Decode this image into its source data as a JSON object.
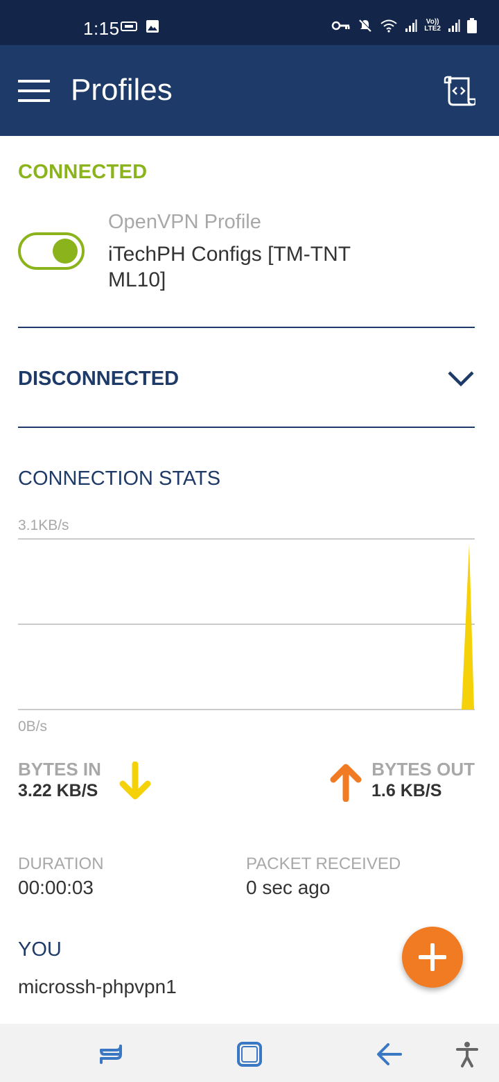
{
  "status_bar": {
    "time": "1:15",
    "lte_line1": "Vo))",
    "lte_line2": "LTE2"
  },
  "app_bar": {
    "title": "Profiles"
  },
  "connected": {
    "heading": "CONNECTED",
    "profile_type": "OpenVPN Profile",
    "profile_name": "iTechPH Configs [TM-TNT ML10]",
    "toggle_on": true
  },
  "disconnected": {
    "heading": "DISCONNECTED"
  },
  "stats": {
    "heading": "CONNECTION STATS",
    "chart_max_label": "3.1KB/s",
    "chart_min_label": "0B/s",
    "bytes_in_label": "BYTES IN",
    "bytes_in_value": "3.22 KB/S",
    "bytes_out_label": "BYTES OUT",
    "bytes_out_value": "1.6 KB/S",
    "duration_label": "DURATION",
    "duration_value": "00:00:03",
    "packet_label": "PACKET RECEIVED",
    "packet_value": "0 sec ago"
  },
  "you": {
    "label": "YOU",
    "value": "microssh-phpvpn1"
  },
  "colors": {
    "status_bar": "#13264a",
    "app_bar": "#1e3a68",
    "connected_green": "#8ab31c",
    "bytes_in_yellow": "#f5d10a",
    "bytes_out_orange": "#f07b22",
    "fab_orange": "#f07b22",
    "nav_blue": "#3b78c4"
  },
  "icons": {
    "menu": "hamburger-icon",
    "import": "import-profile-icon",
    "chevron": "chevron-down-icon",
    "bytes_in": "arrow-down-icon",
    "bytes_out": "arrow-up-icon",
    "fab": "plus-icon"
  }
}
